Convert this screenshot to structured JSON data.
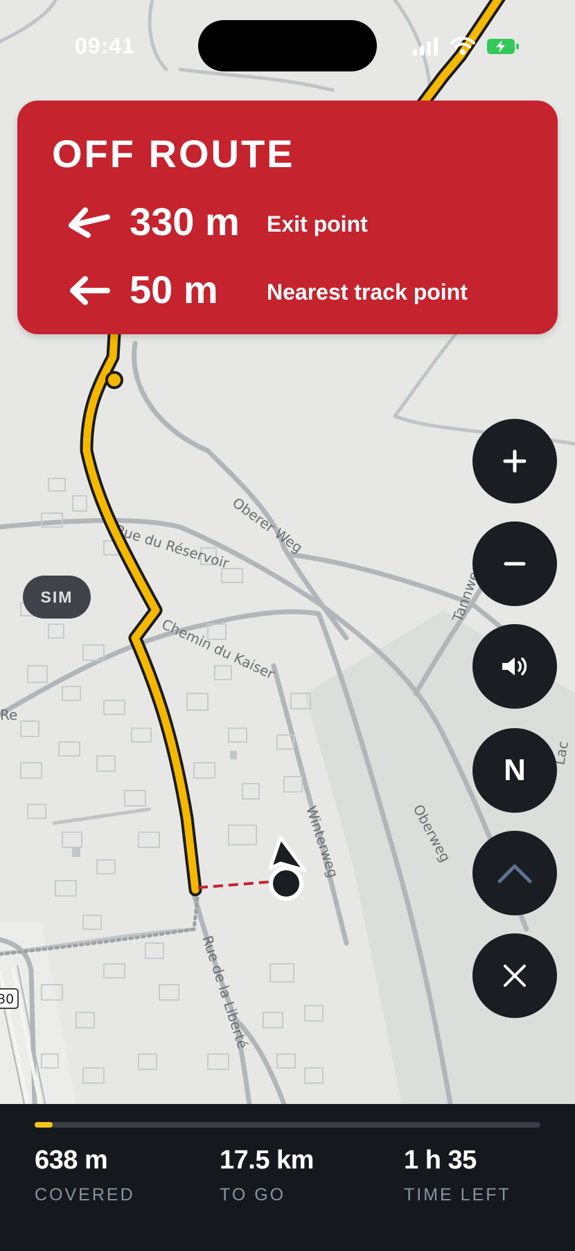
{
  "status_bar": {
    "time": "09:41"
  },
  "off_route_banner": {
    "title": "OFF ROUTE",
    "rows": [
      {
        "distance": "330 m",
        "label": "Exit point"
      },
      {
        "distance": "50 m",
        "label": "Nearest track point"
      }
    ]
  },
  "map": {
    "street_labels": [
      "Rue du Réservoir",
      "Chemin du Kaiser",
      "Rue de la Liberté",
      "Oberer Weg",
      "Oberweg",
      "Winterweg",
      "Tannweg",
      "Re",
      "Lac"
    ],
    "road_number": "30"
  },
  "sim_badge": "SIM",
  "controls": {
    "zoom_in": "+",
    "zoom_out": "−",
    "compass": "N"
  },
  "trip_stats": {
    "progress_fraction": 0.035,
    "covered": {
      "value": "638 m",
      "label": "COVERED"
    },
    "to_go": {
      "value": "17.5 km",
      "label": "TO GO"
    },
    "time_left": {
      "value": "1 h 35",
      "label": "TIME LEFT"
    }
  },
  "colors": {
    "banner": "#c5232e",
    "route": "#f5b800",
    "fab": "#1a1d21",
    "bottom_bar": "#15191d"
  }
}
